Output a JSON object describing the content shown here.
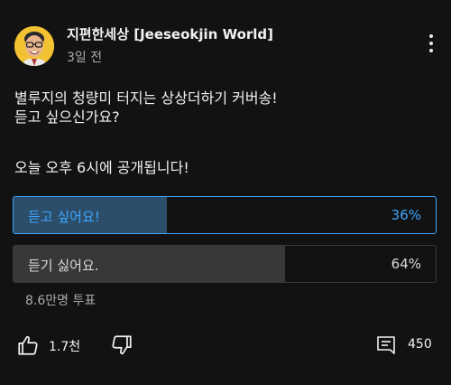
{
  "post": {
    "channel_name": "지편한세상 [Jeeseokjin World]",
    "time_ago": "3일 전",
    "body_line1": "별루지의 청량미 터지는 상상더하기 커버송!",
    "body_line2": "듣고 싶으신가요?",
    "body_line3": "오늘 오후 6시에 공개됩니다!"
  },
  "poll": {
    "options": [
      {
        "label": "듣고 싶어요!",
        "percent_text": "36%",
        "percent": 36,
        "selected": true
      },
      {
        "label": "듣기 싫어요.",
        "percent_text": "64%",
        "percent": 64,
        "selected": false
      }
    ],
    "votes": "8.6만명 투표"
  },
  "actions": {
    "like_count": "1.7천",
    "comment_count": "450"
  },
  "colors": {
    "accent": "#3ea6ff",
    "background": "#121212",
    "secondary_text": "#aaaaaa"
  },
  "icons": {
    "menu": "more-vert-icon",
    "like": "thumbs-up-icon",
    "dislike": "thumbs-down-icon",
    "comment": "comment-icon"
  }
}
